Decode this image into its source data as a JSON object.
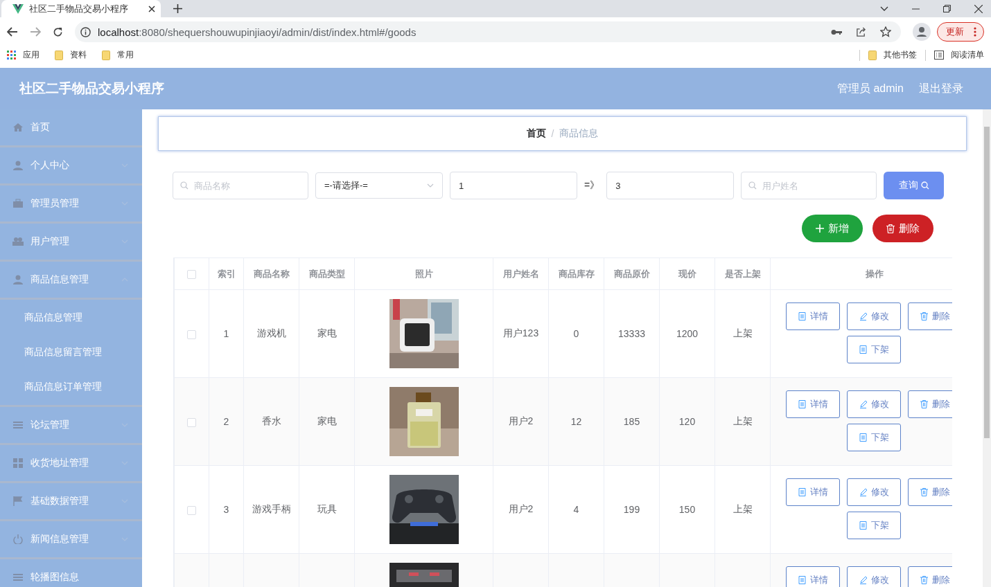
{
  "browser": {
    "tab_title": "社区二手物品交易小程序",
    "url_host": "localhost",
    "url_rest": ":8080/shequershouwupinjiaoyi/admin/dist/index.html#/goods",
    "update_label": "更新",
    "bookmarks": [
      "应用",
      "资料",
      "常用"
    ],
    "bookmarks_right": [
      "其他书签",
      "阅读清单"
    ]
  },
  "header": {
    "title": "社区二手物品交易小程序",
    "user": "管理员 admin",
    "logout": "退出登录"
  },
  "sidebar": {
    "items": [
      {
        "label": "首页",
        "kind": "home",
        "expandable": false
      },
      {
        "label": "个人中心",
        "kind": "person",
        "expandable": true
      },
      {
        "label": "管理员管理",
        "kind": "briefcase",
        "expandable": true
      },
      {
        "label": "用户管理",
        "kind": "people",
        "expandable": true
      },
      {
        "label": "商品信息管理",
        "kind": "person",
        "expandable": true,
        "children": [
          {
            "label": "商品信息管理"
          },
          {
            "label": "商品信息留言管理"
          },
          {
            "label": "商品信息订单管理"
          }
        ]
      },
      {
        "label": "论坛管理",
        "kind": "list",
        "expandable": true
      },
      {
        "label": "收货地址管理",
        "kind": "grid",
        "expandable": true
      },
      {
        "label": "基础数据管理",
        "kind": "flag",
        "expandable": true
      },
      {
        "label": "新闻信息管理",
        "kind": "power",
        "expandable": true
      },
      {
        "label": "轮播图信息",
        "kind": "list",
        "expandable": false
      }
    ]
  },
  "breadcrumb": {
    "separator": "/",
    "items": [
      "首页",
      "商品信息"
    ]
  },
  "filters": {
    "name_placeholder": "商品名称",
    "select_value": "=-请选择-=",
    "from_value": "1",
    "range_sep": "=》",
    "to_value": "3",
    "user_placeholder": "用户姓名",
    "search_label": "查询"
  },
  "actions": {
    "add": "新增",
    "delete": "删除"
  },
  "table": {
    "all_selected": false,
    "columns": [
      "索引",
      "商品名称",
      "商品类型",
      "照片",
      "用户姓名",
      "商品库存",
      "商品原价",
      "现价",
      "是否上架",
      "操作"
    ],
    "rows": [
      {
        "selected": false,
        "cells": [
          "1",
          "游戏机",
          "家电",
          "用户123",
          "0",
          "13333",
          "1200",
          "上架"
        ],
        "buttons": [
          "详情",
          "修改",
          "删除",
          "下架"
        ]
      },
      {
        "selected": false,
        "cells": [
          "2",
          "香水",
          "家电",
          "用户2",
          "12",
          "185",
          "120",
          "上架"
        ],
        "buttons": [
          "详情",
          "修改",
          "删除",
          "下架"
        ]
      },
      {
        "selected": false,
        "cells": [
          "3",
          "游戏手柄",
          "玩具",
          "用户2",
          "4",
          "199",
          "150",
          "上架"
        ],
        "buttons": [
          "详情",
          "修改",
          "删除",
          "下架"
        ]
      },
      {
        "buttons": [
          "详情",
          "修改",
          "删除"
        ]
      }
    ]
  }
}
